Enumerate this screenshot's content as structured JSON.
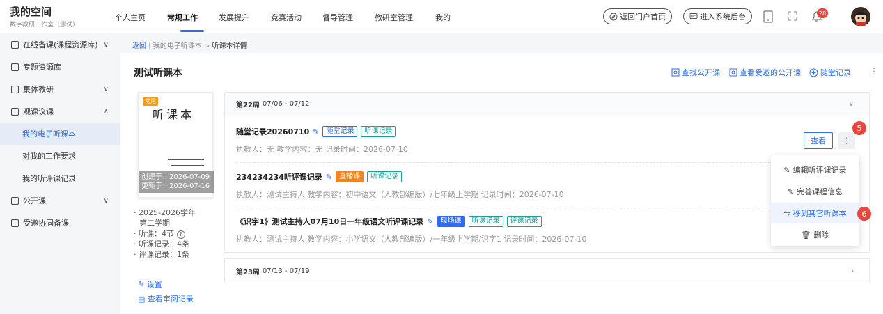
{
  "brand": {
    "title": "我的空间",
    "subtitle": "数字教研工作室（测试）"
  },
  "nav": [
    "个人主页",
    "常规工作",
    "发展提升",
    "竞赛活动",
    "督导管理",
    "教研室管理",
    "我的"
  ],
  "header": {
    "portal_btn": "返回门户首页",
    "admin_btn": "进入系统后台",
    "badge_count": "28"
  },
  "sidebar": [
    {
      "label": "在线备课(课程资源库)"
    },
    {
      "label": "专题资源库"
    },
    {
      "label": "集体教研"
    },
    {
      "label": "观课议课"
    },
    {
      "label": "我的电子听课本"
    },
    {
      "label": "对我的工作要求"
    },
    {
      "label": "我的听评课记录"
    },
    {
      "label": "公开课"
    },
    {
      "label": "受邀协同备课"
    }
  ],
  "breadcrumb": {
    "back": "返回",
    "sep": "|",
    "level1": "我的电子听课本",
    "arrow": ">",
    "current": "听课本详情"
  },
  "page": {
    "title": "测试听课本"
  },
  "actions": {
    "find_public": "查找公开课",
    "invited_public": "查看受邀的公开课",
    "add_record": "随堂记录"
  },
  "book": {
    "tag": "常用",
    "cover_title": "听课本",
    "created": "创建于：2026-07-09",
    "updated": "更新于：2026-07-16",
    "term": "· 2025-2026学年",
    "term2": "第二学期",
    "lessons": "· 听课：4节",
    "records": "· 听课记录：4条",
    "reviews": "· 评课记录：1条",
    "settings": "设置",
    "audit": "查看审阅记录"
  },
  "weeks": [
    {
      "label": "第22周",
      "range": "07/06 - 07/12",
      "records": [
        {
          "title": "随堂记录20260710",
          "tags": [
            "随堂记录",
            "听课记录"
          ],
          "meta": "执教人：无    教学内容：无    记录时间：2026-07-10"
        },
        {
          "title": "234234234听评课记录",
          "tags": [
            "直播课",
            "听课记录"
          ],
          "meta": "执教人：测试主持人    教学内容：初中语文（人教部编版）/七年级上学期    记录时间：2026-07-10"
        },
        {
          "title": "《识字1》测试主持人07月10日一年级语文听评课记录",
          "tags": [
            "现场课",
            "听课记录",
            "评课记录"
          ],
          "meta": "执教人：测试主持人    教学内容：小学语文（人教部编版）/一年级上学期/识字1    记录时间：2026-07-10"
        }
      ]
    },
    {
      "label": "第23周",
      "range": "07/13 - 07/19"
    }
  ],
  "view_btn": "查看",
  "menu": [
    "编辑听评课记录",
    "完善课程信息",
    "移到其它听课本",
    "删除"
  ],
  "steps": [
    "5",
    "6"
  ],
  "colors": {
    "accent": "#2b6cff",
    "orange": "#f5841f",
    "teal": "#1aa198",
    "step": "#e8453c"
  }
}
